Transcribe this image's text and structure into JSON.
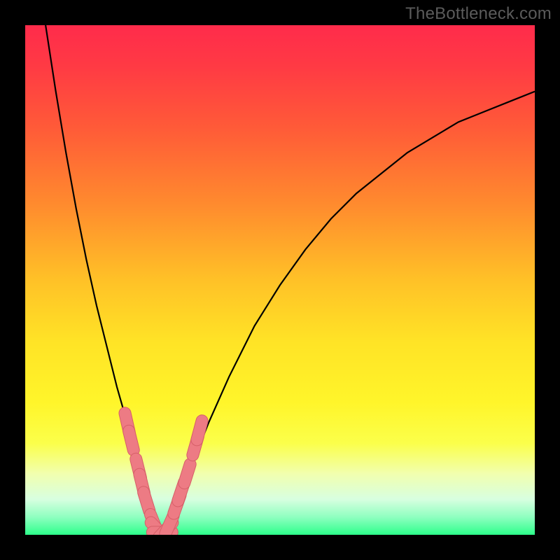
{
  "watermark": {
    "text": "TheBottleneck.com"
  },
  "colors": {
    "frame": "#000000",
    "curve": "#000000",
    "marker_fill": "#ed7b84",
    "marker_stroke": "#d65f68",
    "gradient_stops": [
      {
        "offset": 0.0,
        "color": "#ff2b4b"
      },
      {
        "offset": 0.08,
        "color": "#ff3a44"
      },
      {
        "offset": 0.2,
        "color": "#ff5a38"
      },
      {
        "offset": 0.35,
        "color": "#ff8a2e"
      },
      {
        "offset": 0.5,
        "color": "#ffc127"
      },
      {
        "offset": 0.62,
        "color": "#ffe326"
      },
      {
        "offset": 0.74,
        "color": "#fff52a"
      },
      {
        "offset": 0.82,
        "color": "#fbff4a"
      },
      {
        "offset": 0.88,
        "color": "#f1ffae"
      },
      {
        "offset": 0.93,
        "color": "#d8ffe0"
      },
      {
        "offset": 0.965,
        "color": "#8fffc0"
      },
      {
        "offset": 1.0,
        "color": "#2dff8b"
      }
    ]
  },
  "chart_data": {
    "type": "line",
    "title": "",
    "xlabel": "",
    "ylabel": "",
    "xlim": [
      0,
      100
    ],
    "ylim": [
      0,
      100
    ],
    "grid": false,
    "legend": false,
    "series": [
      {
        "name": "bottleneck-curve",
        "x": [
          4,
          6,
          8,
          10,
          12,
          14,
          16,
          18,
          20,
          22,
          23.5,
          25,
          26,
          27,
          28,
          29,
          32,
          36,
          40,
          45,
          50,
          55,
          60,
          65,
          70,
          75,
          80,
          85,
          90,
          95,
          100
        ],
        "y": [
          100,
          87,
          75,
          64,
          54,
          45,
          37,
          29,
          22,
          15,
          10,
          5,
          2,
          0,
          2,
          5,
          12,
          22,
          31,
          41,
          49,
          56,
          62,
          67,
          71,
          75,
          78,
          81,
          83,
          85,
          87
        ]
      }
    ],
    "markers": {
      "name": "highlighted-points",
      "x": [
        20.0,
        20.8,
        22.2,
        22.9,
        23.8,
        25.3,
        26.0,
        26.9,
        27.6,
        28.3,
        29.8,
        30.6,
        31.8,
        33.4,
        34.2
      ],
      "y": [
        22.0,
        18.5,
        13.0,
        10.0,
        6.5,
        2.2,
        1.0,
        0.5,
        1.0,
        2.0,
        6.0,
        8.5,
        12.0,
        17.5,
        20.5
      ]
    }
  }
}
